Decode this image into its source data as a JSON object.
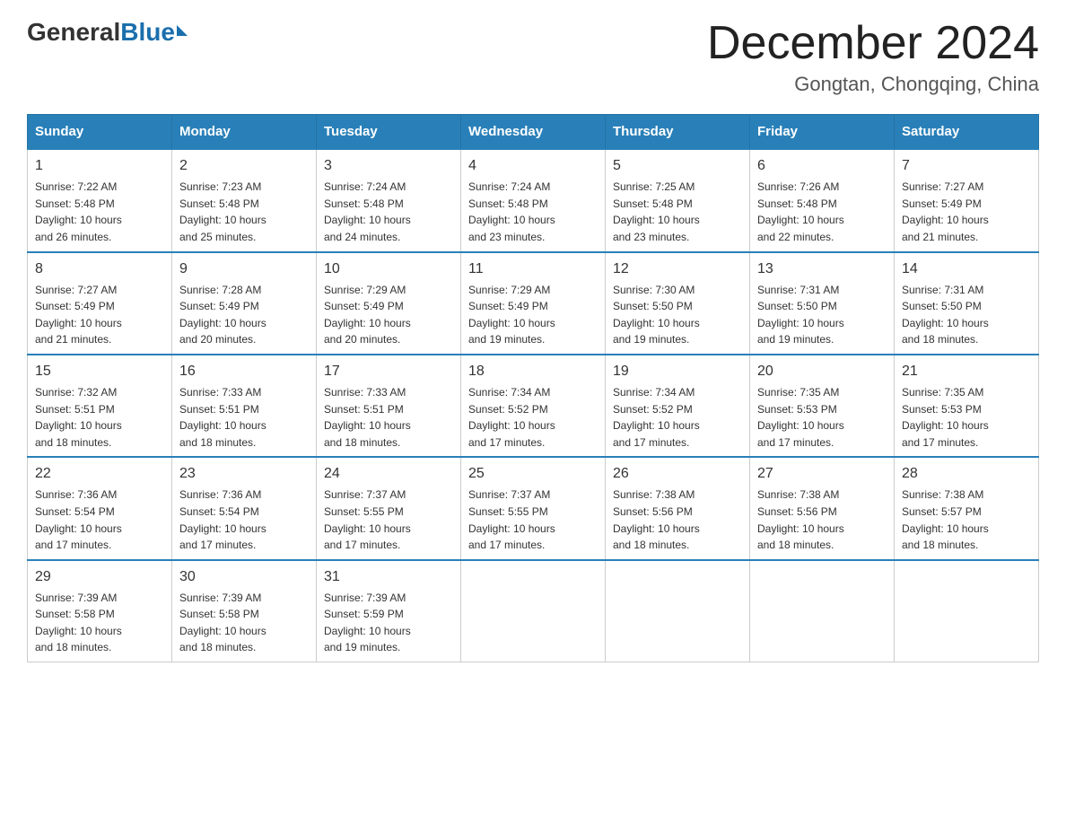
{
  "header": {
    "logo_general": "General",
    "logo_blue": "Blue",
    "month_title": "December 2024",
    "location": "Gongtan, Chongqing, China"
  },
  "days_of_week": [
    "Sunday",
    "Monday",
    "Tuesday",
    "Wednesday",
    "Thursday",
    "Friday",
    "Saturday"
  ],
  "weeks": [
    [
      {
        "day": "1",
        "sunrise": "7:22 AM",
        "sunset": "5:48 PM",
        "daylight": "10 hours and 26 minutes."
      },
      {
        "day": "2",
        "sunrise": "7:23 AM",
        "sunset": "5:48 PM",
        "daylight": "10 hours and 25 minutes."
      },
      {
        "day": "3",
        "sunrise": "7:24 AM",
        "sunset": "5:48 PM",
        "daylight": "10 hours and 24 minutes."
      },
      {
        "day": "4",
        "sunrise": "7:24 AM",
        "sunset": "5:48 PM",
        "daylight": "10 hours and 23 minutes."
      },
      {
        "day": "5",
        "sunrise": "7:25 AM",
        "sunset": "5:48 PM",
        "daylight": "10 hours and 23 minutes."
      },
      {
        "day": "6",
        "sunrise": "7:26 AM",
        "sunset": "5:48 PM",
        "daylight": "10 hours and 22 minutes."
      },
      {
        "day": "7",
        "sunrise": "7:27 AM",
        "sunset": "5:49 PM",
        "daylight": "10 hours and 21 minutes."
      }
    ],
    [
      {
        "day": "8",
        "sunrise": "7:27 AM",
        "sunset": "5:49 PM",
        "daylight": "10 hours and 21 minutes."
      },
      {
        "day": "9",
        "sunrise": "7:28 AM",
        "sunset": "5:49 PM",
        "daylight": "10 hours and 20 minutes."
      },
      {
        "day": "10",
        "sunrise": "7:29 AM",
        "sunset": "5:49 PM",
        "daylight": "10 hours and 20 minutes."
      },
      {
        "day": "11",
        "sunrise": "7:29 AM",
        "sunset": "5:49 PM",
        "daylight": "10 hours and 19 minutes."
      },
      {
        "day": "12",
        "sunrise": "7:30 AM",
        "sunset": "5:50 PM",
        "daylight": "10 hours and 19 minutes."
      },
      {
        "day": "13",
        "sunrise": "7:31 AM",
        "sunset": "5:50 PM",
        "daylight": "10 hours and 19 minutes."
      },
      {
        "day": "14",
        "sunrise": "7:31 AM",
        "sunset": "5:50 PM",
        "daylight": "10 hours and 18 minutes."
      }
    ],
    [
      {
        "day": "15",
        "sunrise": "7:32 AM",
        "sunset": "5:51 PM",
        "daylight": "10 hours and 18 minutes."
      },
      {
        "day": "16",
        "sunrise": "7:33 AM",
        "sunset": "5:51 PM",
        "daylight": "10 hours and 18 minutes."
      },
      {
        "day": "17",
        "sunrise": "7:33 AM",
        "sunset": "5:51 PM",
        "daylight": "10 hours and 18 minutes."
      },
      {
        "day": "18",
        "sunrise": "7:34 AM",
        "sunset": "5:52 PM",
        "daylight": "10 hours and 17 minutes."
      },
      {
        "day": "19",
        "sunrise": "7:34 AM",
        "sunset": "5:52 PM",
        "daylight": "10 hours and 17 minutes."
      },
      {
        "day": "20",
        "sunrise": "7:35 AM",
        "sunset": "5:53 PM",
        "daylight": "10 hours and 17 minutes."
      },
      {
        "day": "21",
        "sunrise": "7:35 AM",
        "sunset": "5:53 PM",
        "daylight": "10 hours and 17 minutes."
      }
    ],
    [
      {
        "day": "22",
        "sunrise": "7:36 AM",
        "sunset": "5:54 PM",
        "daylight": "10 hours and 17 minutes."
      },
      {
        "day": "23",
        "sunrise": "7:36 AM",
        "sunset": "5:54 PM",
        "daylight": "10 hours and 17 minutes."
      },
      {
        "day": "24",
        "sunrise": "7:37 AM",
        "sunset": "5:55 PM",
        "daylight": "10 hours and 17 minutes."
      },
      {
        "day": "25",
        "sunrise": "7:37 AM",
        "sunset": "5:55 PM",
        "daylight": "10 hours and 17 minutes."
      },
      {
        "day": "26",
        "sunrise": "7:38 AM",
        "sunset": "5:56 PM",
        "daylight": "10 hours and 18 minutes."
      },
      {
        "day": "27",
        "sunrise": "7:38 AM",
        "sunset": "5:56 PM",
        "daylight": "10 hours and 18 minutes."
      },
      {
        "day": "28",
        "sunrise": "7:38 AM",
        "sunset": "5:57 PM",
        "daylight": "10 hours and 18 minutes."
      }
    ],
    [
      {
        "day": "29",
        "sunrise": "7:39 AM",
        "sunset": "5:58 PM",
        "daylight": "10 hours and 18 minutes."
      },
      {
        "day": "30",
        "sunrise": "7:39 AM",
        "sunset": "5:58 PM",
        "daylight": "10 hours and 18 minutes."
      },
      {
        "day": "31",
        "sunrise": "7:39 AM",
        "sunset": "5:59 PM",
        "daylight": "10 hours and 19 minutes."
      },
      null,
      null,
      null,
      null
    ]
  ],
  "labels": {
    "sunrise": "Sunrise:",
    "sunset": "Sunset:",
    "daylight": "Daylight:"
  }
}
